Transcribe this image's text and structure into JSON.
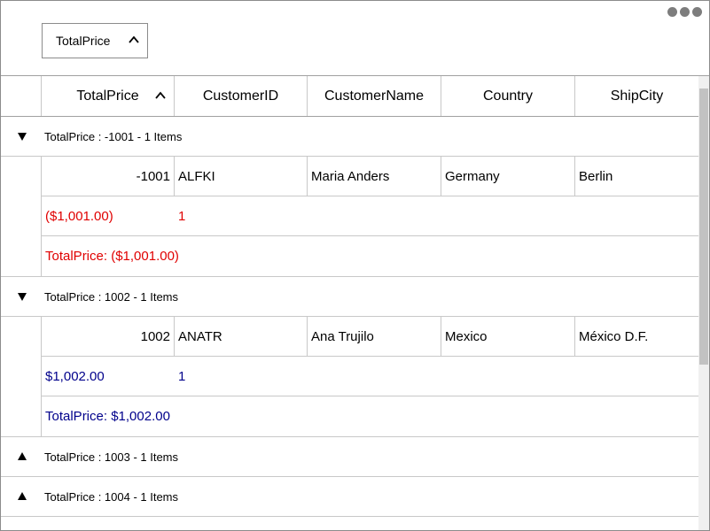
{
  "group_area": {
    "chip_label": "TotalPrice"
  },
  "columns": [
    {
      "label": "TotalPrice"
    },
    {
      "label": "CustomerID"
    },
    {
      "label": "CustomerName"
    },
    {
      "label": "Country"
    },
    {
      "label": "ShipCity"
    }
  ],
  "groups": [
    {
      "caption": "TotalPrice : -1001 - 1 Items",
      "expanded": true,
      "row": {
        "TotalPrice": "-1001",
        "CustomerID": "ALFKI",
        "CustomerName": "Maria Anders",
        "Country": "Germany",
        "ShipCity": "Berlin"
      },
      "summary_sum": "($1,001.00)",
      "summary_count": "1",
      "total_label": "TotalPrice:  ($1,001.00)",
      "sign": "negative"
    },
    {
      "caption": "TotalPrice : 1002 - 1 Items",
      "expanded": true,
      "row": {
        "TotalPrice": "1002",
        "CustomerID": "ANATR",
        "CustomerName": "Ana Trujilo",
        "Country": "Mexico",
        "ShipCity": "México D.F."
      },
      "summary_sum": "$1,002.00",
      "summary_count": "1",
      "total_label": "TotalPrice:  $1,002.00",
      "sign": "positive"
    },
    {
      "caption": "TotalPrice : 1003 - 1 Items",
      "expanded": false
    },
    {
      "caption": "TotalPrice : 1004 - 1 Items",
      "expanded": false
    }
  ],
  "colors": {
    "negative": "#e00000",
    "positive": "#00008b",
    "border": "#c8c8c8"
  },
  "icons": {
    "more": "more-horizontal-icon",
    "sort": "chevron-up-icon",
    "expanded": "triangle-down-icon",
    "collapsed": "triangle-up-icon"
  }
}
